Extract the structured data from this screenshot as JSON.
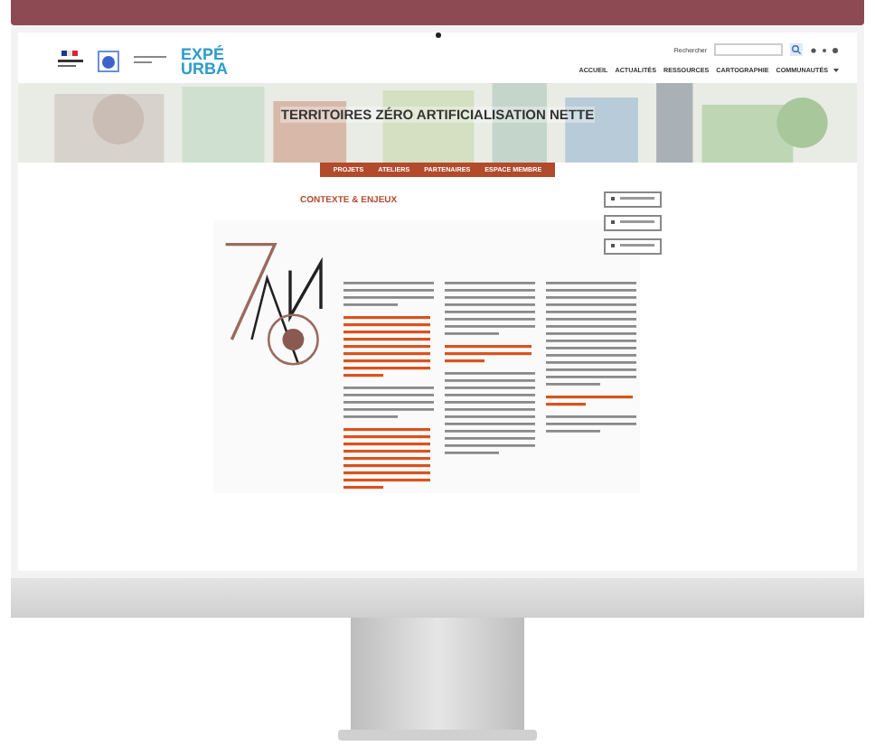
{
  "header": {
    "logo_lines": [
      "EXPÉ",
      "URBA"
    ],
    "search_label": "Rechercher",
    "nav": [
      {
        "label": "ACCUEIL",
        "dropdown": false
      },
      {
        "label": "ACTUALITÉS",
        "dropdown": false
      },
      {
        "label": "RESSOURCES",
        "dropdown": false
      },
      {
        "label": "CARTOGRAPHIE",
        "dropdown": false
      },
      {
        "label": "COMMUNAUTÉS",
        "dropdown": true
      }
    ]
  },
  "hero": {
    "title": "TERRITOIRES ZÉRO ARTIFICIALISATION NETTE"
  },
  "tabs": [
    "PROJETS",
    "ATELIERS",
    "PARTENAIRES",
    "ESPACE MEMBRE"
  ],
  "section": {
    "title": "CONTEXTE & ENJEUX"
  }
}
